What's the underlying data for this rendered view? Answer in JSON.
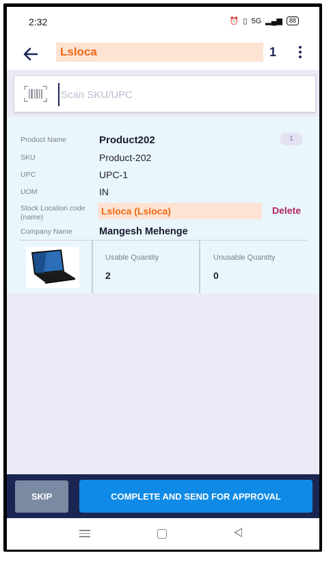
{
  "status_bar": {
    "time": "2:32",
    "battery": "88",
    "signal_text": "5G"
  },
  "header": {
    "title": "Lsloca",
    "count": "1"
  },
  "scan": {
    "placeholder": "Scan SKU/UPC"
  },
  "product": {
    "labels": {
      "name": "Product Name",
      "sku": "SKU",
      "upc": "UPC",
      "uom": "UOM",
      "stock_location": "Stock Location code (name)",
      "company": "Company Name"
    },
    "name": "Product202",
    "badge": "1",
    "sku": "Product-202",
    "upc": "UPC-1",
    "uom": "IN",
    "stock_location": "Lsloca (Lsloca)",
    "delete_label": "Delete",
    "company": "Mangesh Mehenge",
    "usable_label": "Usable Quantity",
    "usable_value": "2",
    "unusable_label": "Unusable Quantity",
    "unusable_value": "0"
  },
  "actions": {
    "skip": "SKIP",
    "complete": "COMPLETE AND SEND FOR APPROVAL"
  },
  "colors": {
    "accent": "#f16a14",
    "navy": "#1b2552",
    "primary": "#0f8ae6",
    "delete": "#b02361"
  }
}
